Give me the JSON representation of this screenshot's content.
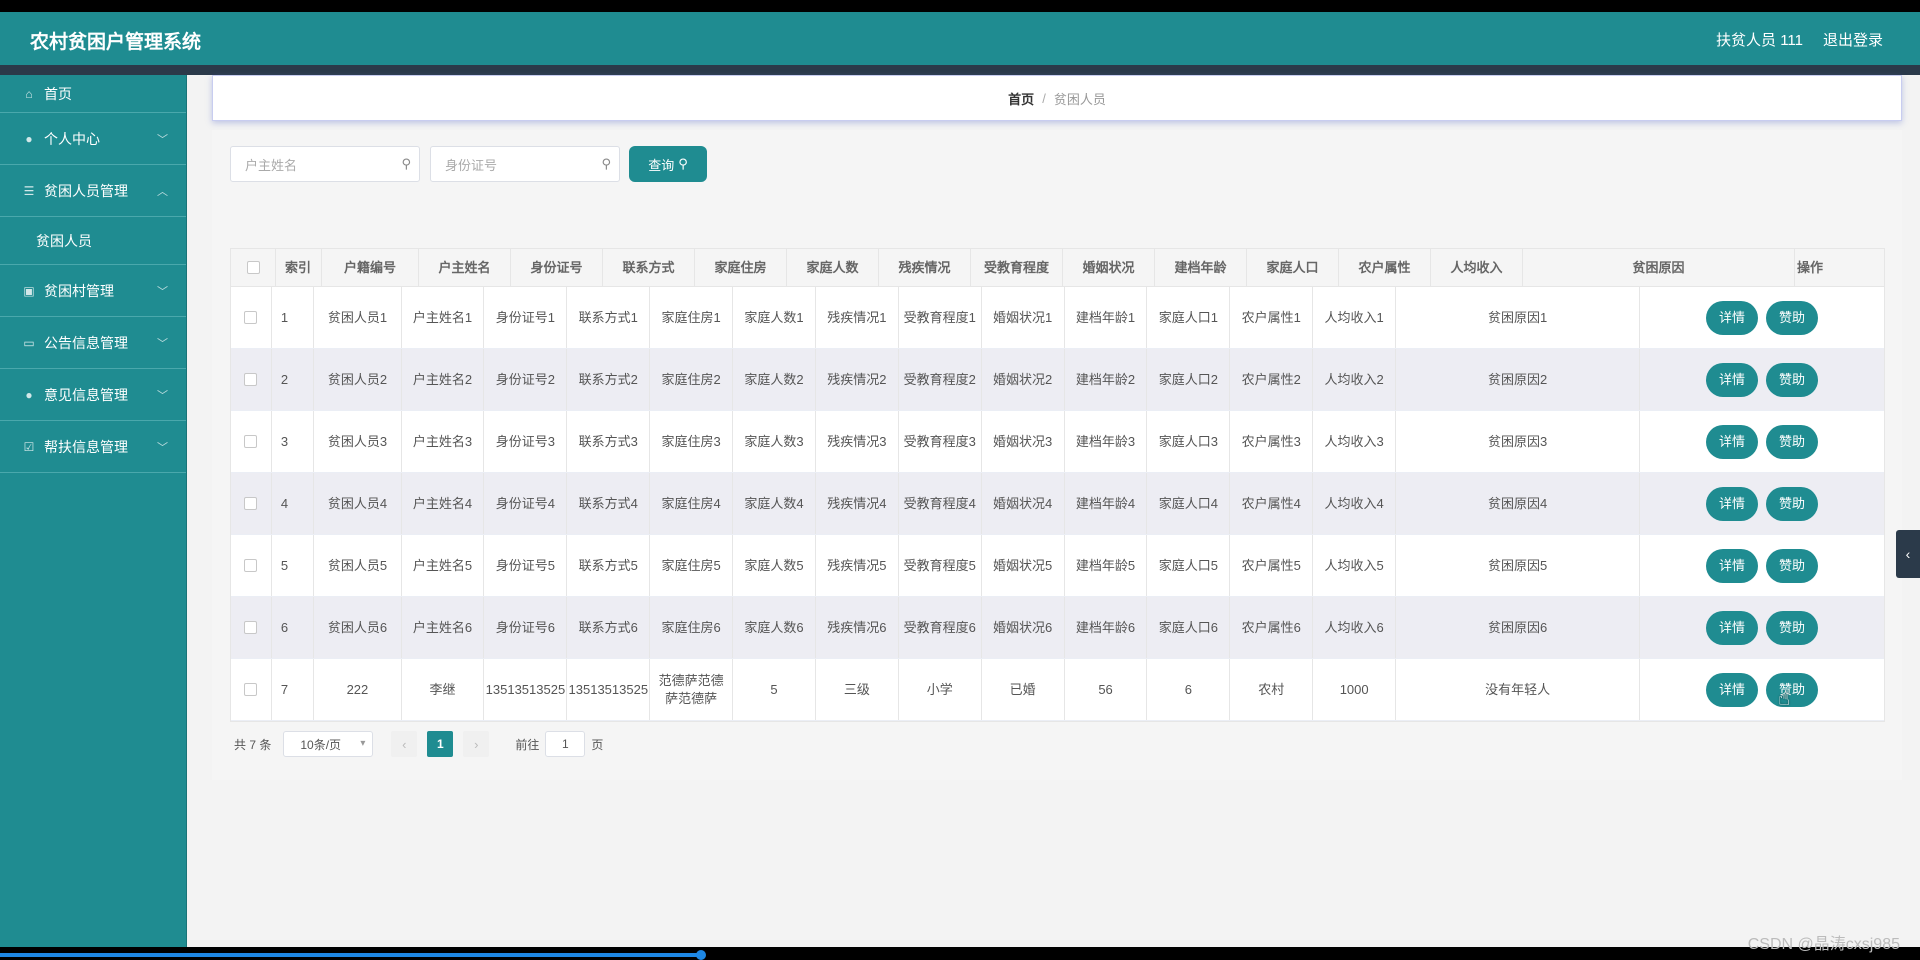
{
  "app": {
    "title": "农村贫困户管理系统",
    "user_label": "扶贫人员 111",
    "logout_label": "退出登录"
  },
  "sidebar": {
    "items": [
      {
        "label": "首页",
        "icon": "home-icon"
      },
      {
        "label": "个人中心",
        "icon": "user-icon"
      },
      {
        "label": "贫困人员管理",
        "icon": "list-icon"
      },
      {
        "label": "贫困村管理",
        "icon": "clipboard-icon"
      },
      {
        "label": "公告信息管理",
        "icon": "monitor-icon"
      },
      {
        "label": "意见信息管理",
        "icon": "user-icon"
      },
      {
        "label": "帮扶信息管理",
        "icon": "checkbox-icon"
      }
    ],
    "sub_item": "贫困人员"
  },
  "breadcrumb": {
    "home": "首页",
    "separator": "/",
    "current": "贫困人员"
  },
  "search": {
    "name_placeholder": "户主姓名",
    "id_placeholder": "身份证号",
    "query_label": "查询"
  },
  "table": {
    "columns": [
      "索引",
      "户籍编号",
      "户主姓名",
      "身份证号",
      "联系方式",
      "家庭住房",
      "家庭人数",
      "残疾情况",
      "受教育程度",
      "婚姻状况",
      "建档年龄",
      "家庭人口",
      "农户属性",
      "人均收入",
      "贫困原因",
      "操作"
    ],
    "rows": [
      [
        "1",
        "贫困人员1",
        "户主姓名1",
        "身份证号1",
        "联系方式1",
        "家庭住房1",
        "家庭人数1",
        "残疾情况1",
        "受教育程度1",
        "婚姻状况1",
        "建档年龄1",
        "家庭人口1",
        "农户属性1",
        "人均收入1",
        "贫困原因1"
      ],
      [
        "2",
        "贫困人员2",
        "户主姓名2",
        "身份证号2",
        "联系方式2",
        "家庭住房2",
        "家庭人数2",
        "残疾情况2",
        "受教育程度2",
        "婚姻状况2",
        "建档年龄2",
        "家庭人口2",
        "农户属性2",
        "人均收入2",
        "贫困原因2"
      ],
      [
        "3",
        "贫困人员3",
        "户主姓名3",
        "身份证号3",
        "联系方式3",
        "家庭住房3",
        "家庭人数3",
        "残疾情况3",
        "受教育程度3",
        "婚姻状况3",
        "建档年龄3",
        "家庭人口3",
        "农户属性3",
        "人均收入3",
        "贫困原因3"
      ],
      [
        "4",
        "贫困人员4",
        "户主姓名4",
        "身份证号4",
        "联系方式4",
        "家庭住房4",
        "家庭人数4",
        "残疾情况4",
        "受教育程度4",
        "婚姻状况4",
        "建档年龄4",
        "家庭人口4",
        "农户属性4",
        "人均收入4",
        "贫困原因4"
      ],
      [
        "5",
        "贫困人员5",
        "户主姓名5",
        "身份证号5",
        "联系方式5",
        "家庭住房5",
        "家庭人数5",
        "残疾情况5",
        "受教育程度5",
        "婚姻状况5",
        "建档年龄5",
        "家庭人口5",
        "农户属性5",
        "人均收入5",
        "贫困原因5"
      ],
      [
        "6",
        "贫困人员6",
        "户主姓名6",
        "身份证号6",
        "联系方式6",
        "家庭住房6",
        "家庭人数6",
        "残疾情况6",
        "受教育程度6",
        "婚姻状况6",
        "建档年龄6",
        "家庭人口6",
        "农户属性6",
        "人均收入6",
        "贫困原因6"
      ],
      [
        "7",
        "222",
        "李继",
        "13513513525",
        "13513513525",
        "范德萨范德萨范德萨",
        "5",
        "三级",
        "小学",
        "已婚",
        "56",
        "6",
        "农村",
        "1000",
        "没有年轻人"
      ]
    ],
    "detail_label": "详情",
    "support_label": "赞助"
  },
  "pagination": {
    "total": "共 7 条",
    "page_size": "10条/页",
    "current_page": "1",
    "goto_prefix": "前往",
    "goto_value": "1",
    "goto_suffix": "页"
  },
  "watermark": "CSDN @晶涛cxsj985",
  "colors": {
    "primary": "#1f8c91",
    "dark": "#2b3a4a"
  }
}
